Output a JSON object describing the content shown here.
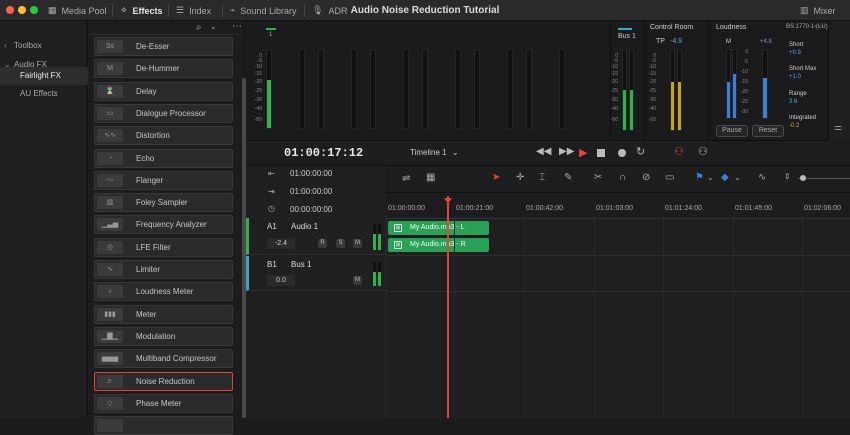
{
  "window": {
    "title": "Audio Noise Reduction Tutorial"
  },
  "toolbar": {
    "media_pool": "Media Pool",
    "effects": "Effects",
    "index": "Index",
    "sound_library": "Sound Library",
    "adr": "ADR",
    "mixer": "Mixer"
  },
  "sidebar": {
    "items": [
      {
        "label": "Toolbox",
        "chevron": "›"
      },
      {
        "label": "Audio FX",
        "chevron": "⌄"
      },
      {
        "label": "Fairlight FX"
      },
      {
        "label": "AU Effects"
      }
    ]
  },
  "effects": {
    "items": [
      {
        "label": "De-Esser",
        "thumb": "Ss"
      },
      {
        "label": "De-Hummer",
        "thumb": "M"
      },
      {
        "label": "Delay",
        "thumb": "⌛"
      },
      {
        "label": "Dialogue Processor",
        "thumb": "▭"
      },
      {
        "label": "Distortion",
        "thumb": "∿∿"
      },
      {
        "label": "Echo",
        "thumb": "◔"
      },
      {
        "label": "Flanger",
        "thumb": "〰"
      },
      {
        "label": "Foley Sampler",
        "thumb": "▥"
      },
      {
        "label": "Frequency Analyzer",
        "thumb": "▁▃▅"
      },
      {
        "label": "LFE Filter",
        "thumb": "◎"
      },
      {
        "label": "Limiter",
        "thumb": "∿"
      },
      {
        "label": "Loudness Meter",
        "thumb": "♪"
      },
      {
        "label": "Meter",
        "thumb": "▮▮▮"
      },
      {
        "label": "Modulation",
        "thumb": "▁▇▁"
      },
      {
        "label": "Multiband Compressor",
        "thumb": "▅▅▅"
      },
      {
        "label": "Noise Reduction",
        "thumb": "♬"
      },
      {
        "label": "Phase Meter",
        "thumb": "◇"
      },
      {
        "label": "",
        "thumb": ""
      }
    ]
  },
  "meters": {
    "track_label": "1",
    "scale": [
      "0",
      "-5",
      "-10",
      "-15",
      "-20",
      "-25",
      "-30",
      "-40",
      "-50"
    ],
    "bus_label": "Bus 1",
    "control_room": {
      "title": "Control Room",
      "tp_label": "TP",
      "tp_value": "-4.9"
    },
    "loudness": {
      "title": "Loudness",
      "standard": "BS.1770-1 (LU)",
      "m_label": "M",
      "m_value": "+4.8",
      "short_label": "Short",
      "short_value": "+0.9",
      "short_max_label": "Short Max",
      "short_max_value": "+1.0",
      "range_label": "Range",
      "range_value": "3.6",
      "integrated_label": "Integrated",
      "integrated_value": "-0.2",
      "pause": "Pause",
      "reset": "Reset",
      "scale": [
        "0",
        "-5",
        "-10",
        "-15",
        "-20",
        "-25",
        "-30"
      ]
    }
  },
  "transport": {
    "timecode": "01:00:17:12",
    "timeline": "Timeline 1"
  },
  "timeline": {
    "tc_rows": [
      "01:00:00:00",
      "01:00:00:00",
      "00:00:00:00"
    ],
    "ruler": [
      "01:00:00:00",
      "01:00:21:00",
      "01:00:42:00",
      "01:01:03:00",
      "01:01:24:00",
      "01:01:45:00",
      "01:02:06:00"
    ],
    "tracks": [
      {
        "id": "A1",
        "name": "Audio 1",
        "volume": "-2.4",
        "r": "R",
        "s": "S",
        "m": "M"
      },
      {
        "id": "B1",
        "name": "Bus 1",
        "volume": "0.0",
        "m": "M"
      }
    ],
    "clips": [
      {
        "label": "My Audio.mp3 - L"
      },
      {
        "label": "My Audio.mp3 - R"
      }
    ]
  },
  "colors": {
    "accent": "#e0453a",
    "clip": "#2aa156",
    "meter_green": "#2fb24a",
    "meter_yellow": "#c9a227",
    "meter_blue": "#3d7fd6"
  }
}
